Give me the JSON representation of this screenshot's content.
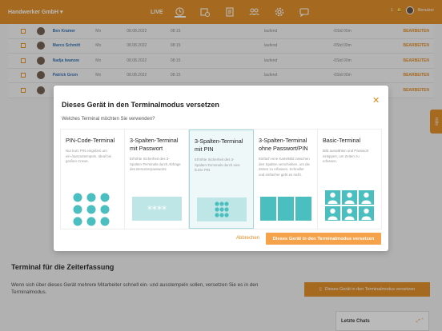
{
  "topbar": {
    "company": "Handwerker GmbH ▾",
    "live": "LIVE",
    "notif": "1",
    "user_name": "Benutzer"
  },
  "table": {
    "rows": [
      {
        "name": "Ben Kramer",
        "day": "Mo",
        "date": "08.08.2022",
        "time": "08:15",
        "status": "laufend",
        "duration": "-0Std 00m",
        "action": "BEARBEITEN"
      },
      {
        "name": "Marco Schmitt",
        "day": "Mo",
        "date": "08.08.2022",
        "time": "08:15",
        "status": "laufend",
        "duration": "-0Std 00m",
        "action": "BEARBEITEN"
      },
      {
        "name": "Nadja Iwanow",
        "day": "Mo",
        "date": "08.08.2022",
        "time": "08:15",
        "status": "laufend",
        "duration": "-0Std 00m",
        "action": "BEARBEITEN"
      },
      {
        "name": "Patrick Grom",
        "day": "Mo",
        "date": "08.08.2022",
        "time": "08:15",
        "status": "laufend",
        "duration": "-0Std 00m",
        "action": "BEARBEITEN"
      },
      {
        "name": "",
        "day": "",
        "date": "",
        "time": "",
        "status": "",
        "duration": "",
        "action": "BEARBEITEN"
      }
    ]
  },
  "modal": {
    "title": "Dieses Gerät in den Terminalmodus versetzen",
    "question": "Welches Terminal möchten Sie verwenden?",
    "cards": [
      {
        "title": "PIN-Code-Terminal",
        "desc": "Nur kurz PIN eingeben um ein-/auszustempeln. Ideal bei großen Crews."
      },
      {
        "title": "3-Spalten-Terminal mit Passwort",
        "desc": "Erhöhte Sicherheit des 3-Spalten-Terminals durch Abfrage des Benutzerpassworts"
      },
      {
        "title": "3-Spalten-Terminal mit PIN",
        "desc": "Erhöhte Sicherheit des 3-Spalten-Terminals durch eine kurze PIN"
      },
      {
        "title": "3-Spalten-Terminal ohne Passwort/PIN",
        "desc": "Einfach eine Karte/Bild zwischen den Spalten verschieben, um die Zeiten zu erfassen. Schneller und einfacher geht es nicht."
      },
      {
        "title": "Basic-Terminal",
        "desc": "Bild auswählen und Passwort eintippen, um Zeiten zu erfassen."
      }
    ],
    "password_mask": "****",
    "cancel": "Abbrechen",
    "confirm": "Dieses Gerät in den Terminalmodus versetzen"
  },
  "section": {
    "title": "Terminal für die Zeiterfassung",
    "desc": "Wenn sich über dieses Gerät mehrere Mitarbeiter schnell ein- und ausstempeln sollen, versetzen Sie es in den Terminalmodus.",
    "button": "Dieses Gerät in den Terminalmodus versetzen"
  },
  "help": "Hilfe",
  "chats": {
    "label": "Letzte Chats"
  },
  "colors": {
    "accent": "#e08a1c",
    "teal": "#4bbfbf"
  }
}
